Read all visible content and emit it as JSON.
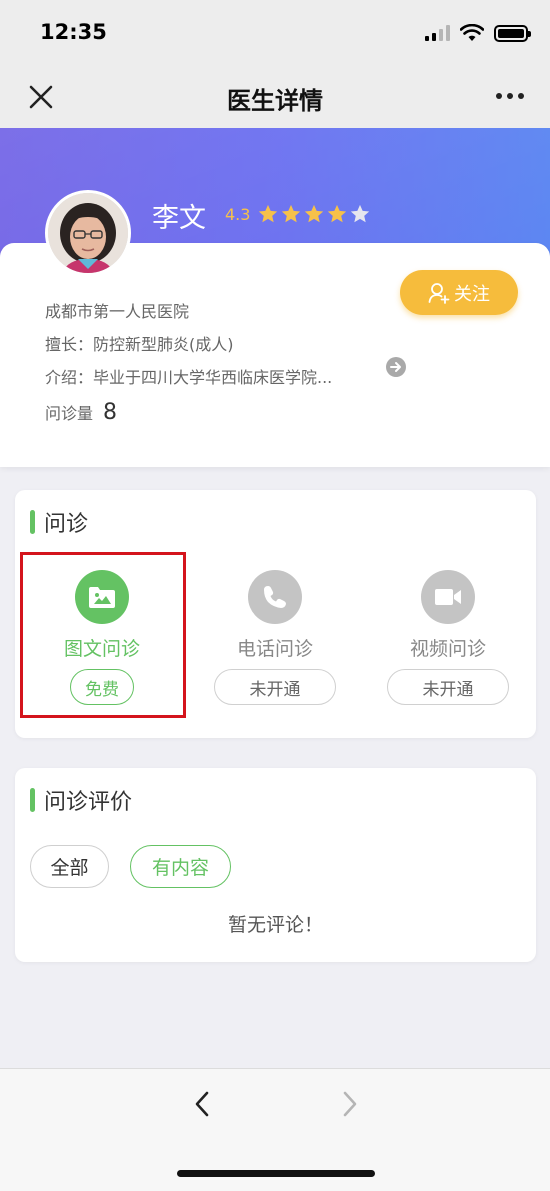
{
  "status_bar": {
    "time": "12:35"
  },
  "nav": {
    "title": "医生详情"
  },
  "doctor": {
    "name": "李文",
    "rating": "4.3",
    "stars_filled": 4,
    "stars_total": 5,
    "follow_label": "关注",
    "hospital": "成都市第一人民医院",
    "specialty": "擅长：防控新型肺炎(成人)",
    "intro": "介绍：毕业于四川大学华西临床医学院...",
    "consult_count_label": "问诊量",
    "consult_count": "8"
  },
  "consult": {
    "section_title": "问诊",
    "items": [
      {
        "label": "图文问诊",
        "status": "免费",
        "icon": "image-folder-icon",
        "active": true
      },
      {
        "label": "电话问诊",
        "status": "未开通",
        "icon": "phone-icon",
        "active": false
      },
      {
        "label": "视频问诊",
        "status": "未开通",
        "icon": "video-camera-icon",
        "active": false
      }
    ]
  },
  "reviews": {
    "section_title": "问诊评价",
    "filters": [
      {
        "label": "全部",
        "active": false
      },
      {
        "label": "有内容",
        "active": true
      }
    ],
    "empty_text": "暂无评论！"
  },
  "colors": {
    "accent_green": "#64c263",
    "follow_yellow": "#f6bc3c",
    "hero_purple": "#7163e6",
    "star_gold": "#f6c14a",
    "inactive_gray": "#c4c4c4",
    "highlight_red": "#d4141c"
  }
}
